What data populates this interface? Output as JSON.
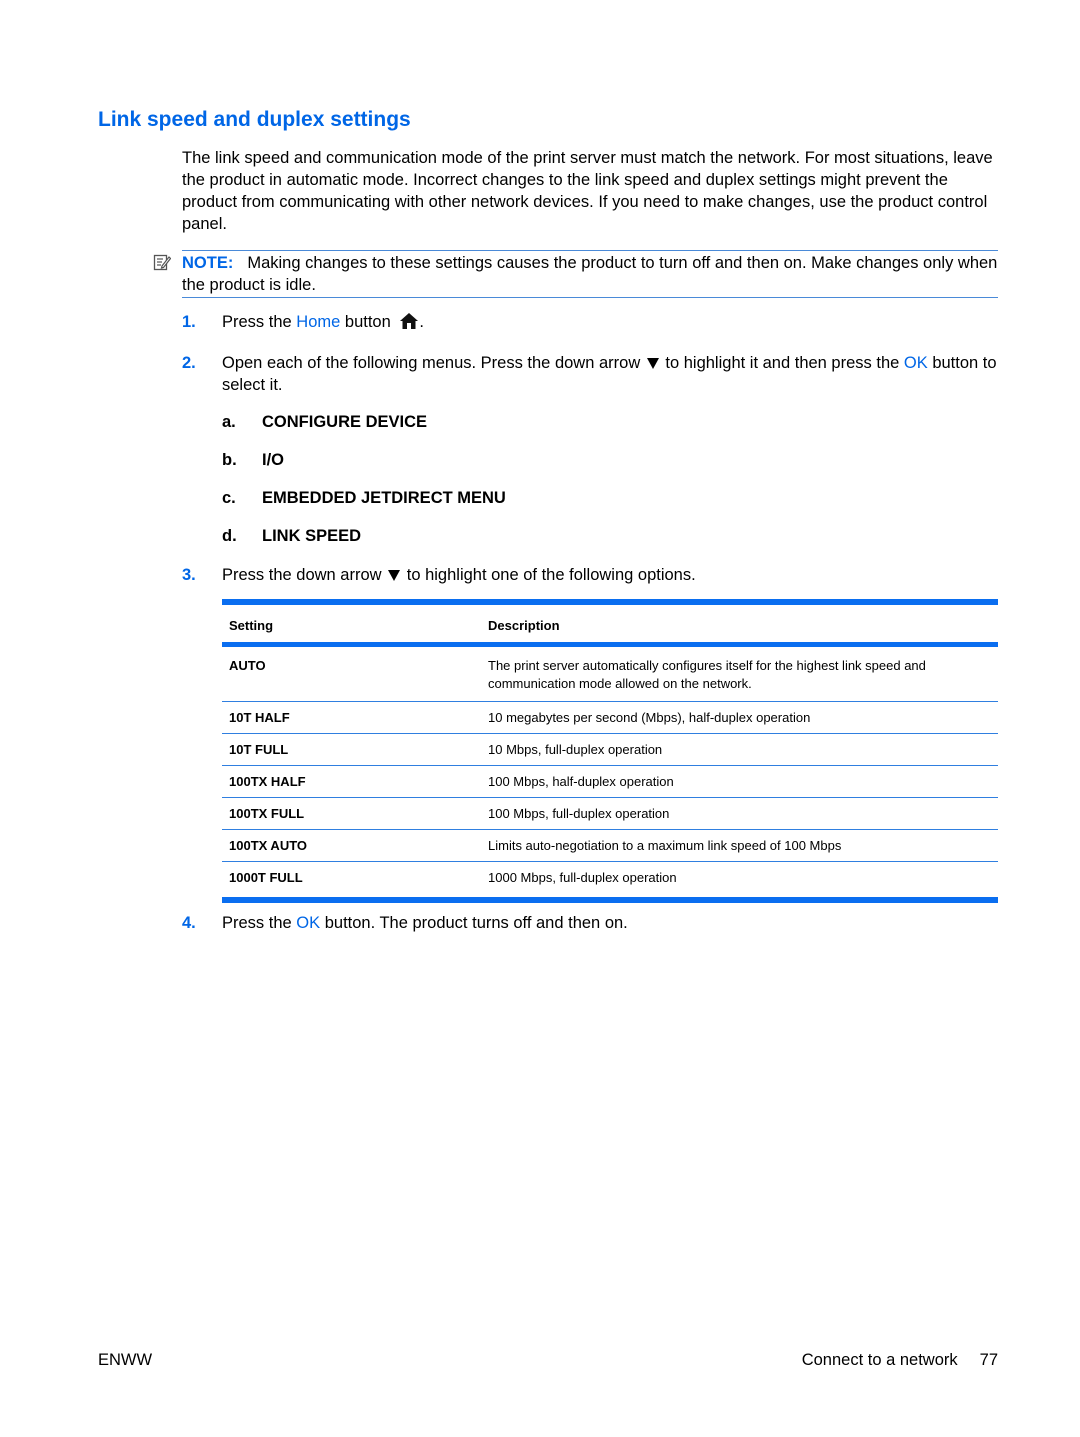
{
  "section": {
    "title": "Link speed and duplex settings",
    "intro": "The link speed and communication mode of the print server must match the network. For most situations, leave the product in automatic mode. Incorrect changes to the link speed and duplex settings might prevent the product from communicating with other network devices. If you need to make changes, use the product control panel."
  },
  "note": {
    "icon": "note-icon",
    "label": "NOTE:",
    "text": "Making changes to these settings causes the product to turn off and then on. Make changes only when the product is idle."
  },
  "steps": [
    {
      "num": "1.",
      "pre": "Press the ",
      "link": "Home",
      "post": " button",
      "icon": "home-icon",
      "end": "."
    },
    {
      "num": "2.",
      "pre": "Open each of the following menus. Press the down arrow ",
      "icon": "down-arrow-icon",
      "mid": " to highlight it and then press the ",
      "link": "OK",
      "post": " button to select it.",
      "substeps": [
        {
          "letter": "a.",
          "label": "CONFIGURE DEVICE"
        },
        {
          "letter": "b.",
          "label": "I/O"
        },
        {
          "letter": "c.",
          "label": "EMBEDDED JETDIRECT MENU"
        },
        {
          "letter": "d.",
          "label": "LINK SPEED"
        }
      ]
    },
    {
      "num": "3.",
      "pre": "Press the down arrow ",
      "icon": "down-arrow-icon",
      "post": " to highlight one of the following options."
    },
    {
      "num": "4.",
      "pre": "Press the ",
      "link": "OK",
      "post": " button. The product turns off and then on."
    }
  ],
  "table": {
    "headers": [
      "Setting",
      "Description"
    ],
    "rows": [
      {
        "setting": "AUTO",
        "description": "The print server automatically configures itself for the highest link speed and communication mode allowed on the network."
      },
      {
        "setting": "10T HALF",
        "description": "10 megabytes per second (Mbps), half-duplex operation"
      },
      {
        "setting": "10T FULL",
        "description": "10 Mbps, full-duplex operation"
      },
      {
        "setting": "100TX HALF",
        "description": "100 Mbps, half-duplex operation"
      },
      {
        "setting": "100TX FULL",
        "description": "100 Mbps, full-duplex operation"
      },
      {
        "setting": "100TX AUTO",
        "description": "Limits auto-negotiation to a maximum link speed of 100 Mbps"
      },
      {
        "setting": "1000T FULL",
        "description": "1000 Mbps, full-duplex operation"
      }
    ]
  },
  "footer": {
    "left": "ENWW",
    "chapter": "Connect to a network",
    "page": "77"
  },
  "colors": {
    "accent": "#0066e6",
    "rule": "#0a6ef0"
  }
}
